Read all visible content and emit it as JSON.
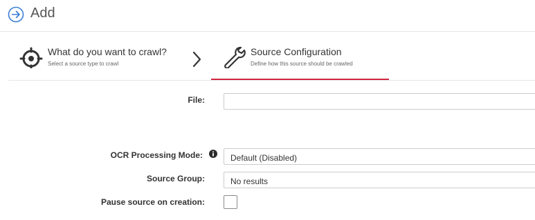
{
  "header": {
    "title": "Add",
    "icon": "arrow-circle-right-icon"
  },
  "steps": [
    {
      "title": "What do you want to crawl?",
      "subtitle": "Select a source type to crawl",
      "icon": "crosshair-target-icon"
    },
    {
      "title": "Source Configuration",
      "subtitle": "Define how this source should be crawled",
      "icon": "wrench-icon",
      "active": true
    }
  ],
  "form": {
    "file_label": "File:",
    "file_value": "",
    "ocr_label": "OCR Processing Mode:",
    "ocr_value": "Default (Disabled)",
    "source_group_label": "Source Group:",
    "source_group_value": "No results",
    "pause_label": "Pause source on creation:",
    "pause_checked": false
  },
  "colors": {
    "accent": "#d0253f",
    "icon_blue": "#3b7dd8",
    "text": "#333333"
  }
}
